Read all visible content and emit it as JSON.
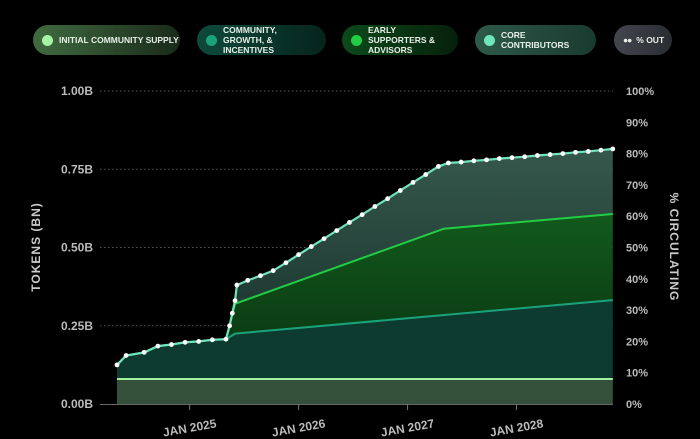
{
  "legend": [
    {
      "label": "INITIAL COMMUNITY SUPPLY",
      "color": "#a6f5a6"
    },
    {
      "label": "COMMUNITY, GROWTH, & INCENTIVES",
      "color": "#1aa37a"
    },
    {
      "label": "EARLY SUPPORTERS & ADVISORS",
      "color": "#22cc44"
    },
    {
      "label": "CORE CONTRIBUTORS",
      "color": "#6fe5bd"
    },
    {
      "label": "% OUT",
      "icon": "two-dots-icon"
    }
  ],
  "chart_data": {
    "type": "area",
    "x_unit": "months since Jan 2024",
    "xlim": [
      4,
      58.6
    ],
    "ylabel": "TOKENS (BN)",
    "ylabel_right": "% CIRCULATING",
    "ylim": [
      0,
      1
    ],
    "yticks": [
      "0.00B",
      "0.25B",
      "0.50B",
      "0.75B",
      "1.00B"
    ],
    "yticks_right": [
      "0%",
      "10%",
      "20%",
      "30%",
      "40%",
      "50%",
      "60%",
      "70%",
      "80%",
      "90%",
      "100%"
    ],
    "xticks": [
      {
        "m": 12,
        "label": "JAN 2025"
      },
      {
        "m": 24,
        "label": "JAN 2026"
      },
      {
        "m": 36,
        "label": "JAN 2027"
      },
      {
        "m": 48,
        "label": "JAN 2028"
      }
    ],
    "series": [
      {
        "name": "Initial Community Supply",
        "points": [
          [
            4,
            0.08
          ],
          [
            58.6,
            0.08
          ]
        ]
      },
      {
        "name": "Community, Growth, & Incentives",
        "points": [
          [
            4,
            0.125
          ],
          [
            5,
            0.155
          ],
          [
            7,
            0.165
          ],
          [
            8.5,
            0.185
          ],
          [
            10,
            0.19
          ],
          [
            11.5,
            0.197
          ],
          [
            13,
            0.2
          ],
          [
            14.5,
            0.205
          ],
          [
            16,
            0.207
          ],
          [
            17,
            0.225
          ],
          [
            58.6,
            0.332
          ]
        ]
      },
      {
        "name": "Early Supporters & Advisors",
        "points": [
          [
            4,
            0.125
          ],
          [
            5,
            0.155
          ],
          [
            7,
            0.165
          ],
          [
            8.5,
            0.185
          ],
          [
            10,
            0.19
          ],
          [
            11.5,
            0.197
          ],
          [
            13,
            0.2
          ],
          [
            14.5,
            0.205
          ],
          [
            16,
            0.207
          ],
          [
            17,
            0.32
          ],
          [
            40,
            0.56
          ],
          [
            58.6,
            0.607
          ]
        ]
      },
      {
        "name": "Core Contributors (total)",
        "points": [
          [
            4,
            0.125
          ],
          [
            5,
            0.155
          ],
          [
            7,
            0.165
          ],
          [
            8.5,
            0.185
          ],
          [
            10,
            0.19
          ],
          [
            11.5,
            0.197
          ],
          [
            13,
            0.2
          ],
          [
            14.5,
            0.205
          ],
          [
            16,
            0.207
          ],
          [
            16.4,
            0.25
          ],
          [
            16.7,
            0.29
          ],
          [
            17,
            0.33
          ],
          [
            17.2,
            0.38
          ],
          [
            18.4,
            0.395
          ],
          [
            19.8,
            0.41
          ],
          [
            21.2,
            0.426
          ],
          [
            22.6,
            0.451
          ],
          [
            24,
            0.477
          ],
          [
            25.4,
            0.503
          ],
          [
            26.8,
            0.528
          ],
          [
            28.2,
            0.554
          ],
          [
            29.6,
            0.58
          ],
          [
            31,
            0.605
          ],
          [
            32.4,
            0.631
          ],
          [
            33.8,
            0.656
          ],
          [
            35.2,
            0.682
          ],
          [
            36.6,
            0.708
          ],
          [
            38,
            0.733
          ],
          [
            39.4,
            0.759
          ],
          [
            40.5,
            0.77
          ],
          [
            41.9,
            0.773
          ],
          [
            43.3,
            0.777
          ],
          [
            44.7,
            0.78
          ],
          [
            46.1,
            0.784
          ],
          [
            47.5,
            0.787
          ],
          [
            48.9,
            0.79
          ],
          [
            50.3,
            0.794
          ],
          [
            51.7,
            0.797
          ],
          [
            53.1,
            0.8
          ],
          [
            54.5,
            0.804
          ],
          [
            55.9,
            0.807
          ],
          [
            57.3,
            0.811
          ],
          [
            58.6,
            0.815
          ]
        ]
      }
    ]
  }
}
